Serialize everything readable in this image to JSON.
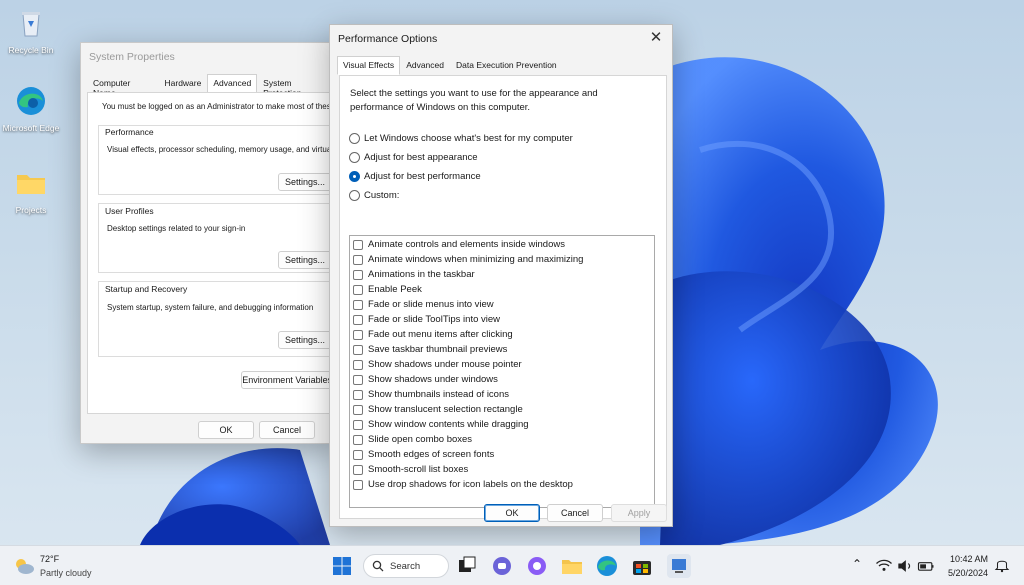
{
  "desktop": {
    "icons": [
      {
        "label": "Recycle Bin",
        "icon": "recycle-bin-icon"
      },
      {
        "label": "Microsoft Edge",
        "icon": "edge-icon"
      },
      {
        "label": "Projects",
        "icon": "folder-icon"
      }
    ]
  },
  "system_properties": {
    "title": "System Properties",
    "tabs": [
      "Computer Name",
      "Hardware",
      "Advanced",
      "System Protection"
    ],
    "active_tab": "Advanced",
    "admin_note": "You must be logged on as an Administrator to make most of these changes.",
    "groups": [
      {
        "title": "Performance",
        "text": "Visual effects, processor scheduling, memory usage, and virtual memory",
        "button": "Settings..."
      },
      {
        "title": "User Profiles",
        "text": "Desktop settings related to your sign-in",
        "button": "Settings..."
      },
      {
        "title": "Startup and Recovery",
        "text": "System startup, system failure, and debugging information",
        "button": "Settings..."
      }
    ],
    "env_button": "Environment Variables...",
    "ok": "OK",
    "cancel": "Cancel"
  },
  "performance_options": {
    "title": "Performance Options",
    "tabs": [
      "Visual Effects",
      "Advanced",
      "Data Execution Prevention"
    ],
    "active_tab": "Visual Effects",
    "intro": "Select the settings you want to use for the appearance and performance of Windows on this computer.",
    "radios": [
      {
        "label": "Let Windows choose what's best for my computer",
        "checked": false
      },
      {
        "label": "Adjust for best appearance",
        "checked": false
      },
      {
        "label": "Adjust for best performance",
        "checked": true
      },
      {
        "label": "Custom:",
        "checked": false
      }
    ],
    "effects": [
      {
        "label": "Animate controls and elements inside windows",
        "checked": false
      },
      {
        "label": "Animate windows when minimizing and maximizing",
        "checked": false
      },
      {
        "label": "Animations in the taskbar",
        "checked": false
      },
      {
        "label": "Enable Peek",
        "checked": false
      },
      {
        "label": "Fade or slide menus into view",
        "checked": false
      },
      {
        "label": "Fade or slide ToolTips into view",
        "checked": false
      },
      {
        "label": "Fade out menu items after clicking",
        "checked": false
      },
      {
        "label": "Save taskbar thumbnail previews",
        "checked": false
      },
      {
        "label": "Show shadows under mouse pointer",
        "checked": false
      },
      {
        "label": "Show shadows under windows",
        "checked": false
      },
      {
        "label": "Show thumbnails instead of icons",
        "checked": false
      },
      {
        "label": "Show translucent selection rectangle",
        "checked": false
      },
      {
        "label": "Show window contents while dragging",
        "checked": false
      },
      {
        "label": "Slide open combo boxes",
        "checked": false
      },
      {
        "label": "Smooth edges of screen fonts",
        "checked": false
      },
      {
        "label": "Smooth-scroll list boxes",
        "checked": false
      },
      {
        "label": "Use drop shadows for icon labels on the desktop",
        "checked": false
      }
    ],
    "ok": "OK",
    "cancel": "Cancel",
    "apply": "Apply"
  },
  "taskbar": {
    "weather_temp": "72°F",
    "weather_desc": "Partly cloudy",
    "search_label": "Search",
    "time": "10:42 AM",
    "date": "5/20/2024"
  }
}
